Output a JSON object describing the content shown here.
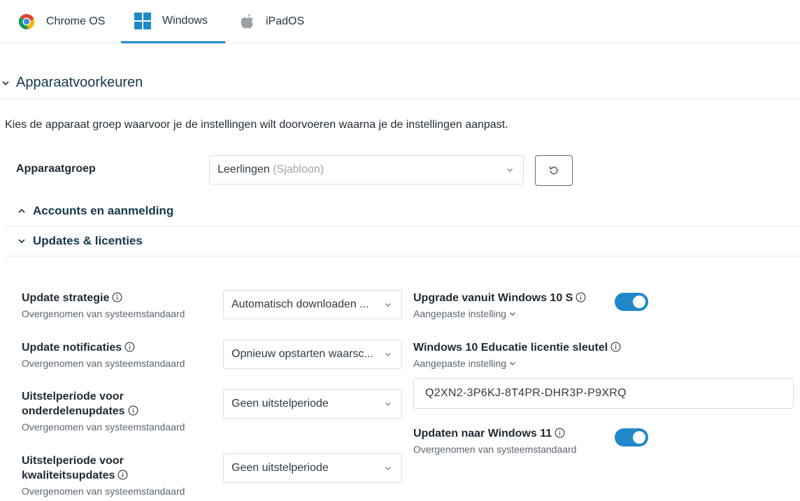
{
  "tabs": [
    {
      "label": "Chrome OS",
      "icon": "chrome-icon",
      "active": false
    },
    {
      "label": "Windows",
      "icon": "windows-icon",
      "active": true
    },
    {
      "label": "iPadOS",
      "icon": "apple-icon",
      "active": false
    }
  ],
  "section": {
    "title": "Apparaatvoorkeuren",
    "expanded": true
  },
  "intro": "Kies de apparaat groep waarvoor je de instellingen wilt doorvoeren waarna je de instellingen aanpast.",
  "device_group": {
    "label": "Apparaatgroep",
    "value": "Leerlingen",
    "hint": "(Sjabloon)",
    "reset_icon": "reset-icon"
  },
  "subsections": [
    {
      "title": "Accounts en aanmelding",
      "expanded": false
    },
    {
      "title": "Updates & licenties",
      "expanded": true
    }
  ],
  "settings_left": [
    {
      "label": "Update strategie",
      "sub": "Overgenomen van systeemstandaard",
      "value": "Automatisch downloaden ..."
    },
    {
      "label": "Update notificaties",
      "sub": "Overgenomen van systeemstandaard",
      "value": "Opnieuw opstarten waarsc..."
    },
    {
      "label_line1": "Uitstelperiode voor",
      "label_line2": "onderdelenupdates",
      "sub": "Overgenomen van systeemstandaard",
      "value": "Geen uitstelperiode"
    },
    {
      "label_line1": "Uitstelperiode voor",
      "label_line2": "kwaliteitsupdates",
      "sub": "Overgenomen van systeemstandaard",
      "value": "Geen uitstelperiode"
    }
  ],
  "settings_right": {
    "upgrade_10s": {
      "label": "Upgrade vanuit Windows 10 S",
      "sub": "Aangepaste instelling",
      "enabled": true
    },
    "license_key": {
      "label": "Windows 10 Educatie licentie sleutel",
      "sub": "Aangepaste instelling",
      "value": "Q2XN2-3P6KJ-8T4PR-DHR3P-P9XRQ"
    },
    "update_11": {
      "label": "Updaten naar Windows 11",
      "sub": "Overgenomen van systeemstandaard",
      "enabled": true
    }
  },
  "colors": {
    "accent": "#1e88c9",
    "heading": "#12384d",
    "border": "#d8dde2"
  }
}
